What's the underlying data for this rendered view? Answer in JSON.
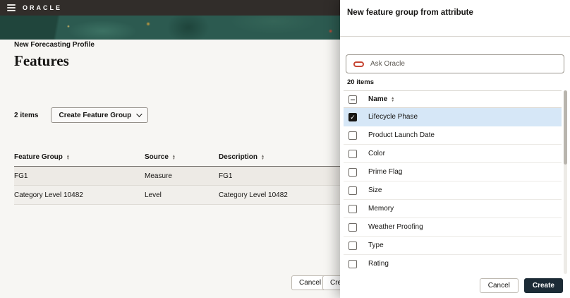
{
  "colors": {
    "accent": "#c74634",
    "primary": "#1c2b36",
    "selection": "#d6e7f7"
  },
  "header": {
    "brand": "ORACLE"
  },
  "page": {
    "breadcrumb": "New Forecasting Profile",
    "title": "Features",
    "items_count": "2 items",
    "create_group_label": "Create Feature Group",
    "table": {
      "columns": [
        "Feature Group",
        "Source",
        "Description"
      ],
      "rows": [
        {
          "feature_group": "FG1",
          "source": "Measure",
          "description": "FG1"
        },
        {
          "feature_group": "Category Level 10482",
          "source": "Level",
          "description": "Category Level 10482"
        }
      ]
    },
    "footer": {
      "cancel_label": "Cancel",
      "partial_label": "Create"
    }
  },
  "panel": {
    "title": "New feature group from attribute",
    "search": {
      "placeholder": "Ask Oracle"
    },
    "items_count": "20 items",
    "name_column": "Name",
    "rows": [
      {
        "label": "Lifecycle Phase",
        "checked": true,
        "selected": true
      },
      {
        "label": "Product Launch Date",
        "checked": false,
        "selected": false
      },
      {
        "label": "Color",
        "checked": false,
        "selected": false
      },
      {
        "label": "Prime Flag",
        "checked": false,
        "selected": false
      },
      {
        "label": "Size",
        "checked": false,
        "selected": false
      },
      {
        "label": "Memory",
        "checked": false,
        "selected": false
      },
      {
        "label": "Weather Proofing",
        "checked": false,
        "selected": false
      },
      {
        "label": "Type",
        "checked": false,
        "selected": false
      },
      {
        "label": "Rating",
        "checked": false,
        "selected": false
      }
    ],
    "footer": {
      "cancel_label": "Cancel",
      "create_label": "Create"
    }
  }
}
